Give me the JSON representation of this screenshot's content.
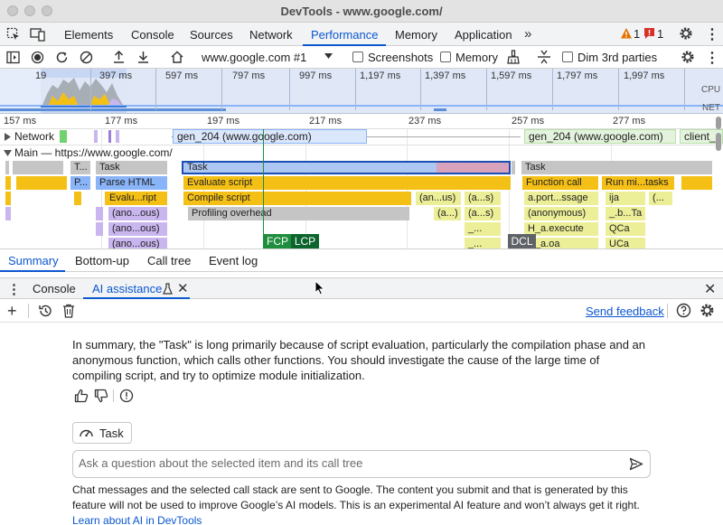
{
  "window": {
    "title": "DevTools - www.google.com/"
  },
  "main_tabs": [
    {
      "label": "Elements"
    },
    {
      "label": "Console"
    },
    {
      "label": "Sources"
    },
    {
      "label": "Network"
    },
    {
      "label": "Performance"
    },
    {
      "label": "Memory"
    },
    {
      "label": "Application"
    }
  ],
  "badges": {
    "warnings": "1",
    "errors": "1"
  },
  "perf_toolbar": {
    "target": "www.google.com #1",
    "screenshots_label": "Screenshots",
    "memory_label": "Memory",
    "dim_label": "Dim 3rd parties"
  },
  "overview": {
    "ticks": [
      "19",
      "397 ms",
      "597 ms",
      "797 ms",
      "997 ms",
      "1,197 ms",
      "1,397 ms",
      "1,597 ms",
      "1,797 ms",
      "1,997 ms"
    ],
    "cpu_label": "CPU",
    "net_label": "NET"
  },
  "ruler": {
    "ticks": [
      "157 ms",
      "177 ms",
      "197 ms",
      "217 ms",
      "237 ms",
      "257 ms",
      "277 ms"
    ]
  },
  "tracks": {
    "network_label": "Network",
    "network_items": [
      "gen_204 (www.google.com)",
      "gen_204 (www.google.com)",
      "client_"
    ],
    "main_label": "Main — https://www.google.com/"
  },
  "flame": {
    "row1": [
      "T...",
      "Task",
      "Task",
      "Task"
    ],
    "row2": [
      "P...",
      "Parse HTML",
      "Evaluate script",
      "Function call",
      "Run mi...tasks"
    ],
    "row3": [
      "Evalu...ript",
      "Compile script",
      "(an...us)",
      "(a...s)",
      "a.port...ssage",
      "ija",
      "(..."
    ],
    "row4": [
      "(ano...ous)",
      "Profiling overhead",
      "(a...)",
      "(a...s)",
      "(anonymous)",
      "_.b...Ta"
    ],
    "row5": [
      "(ano...ous)",
      "_...",
      "H_a.execute",
      "QCa"
    ],
    "row6": [
      "(ano...ous)",
      "_...",
      "H_a.oa",
      "UCa"
    ],
    "markers": [
      "FCP",
      "LCP",
      "DCL"
    ]
  },
  "bottom_tabs": [
    "Summary",
    "Bottom-up",
    "Call tree",
    "Event log"
  ],
  "drawer": {
    "tabs": [
      "Console",
      "AI assistance"
    ]
  },
  "ai": {
    "send_feedback": "Send feedback",
    "answer": "In summary, the \"Task\" is long primarily because of script evaluation, particularly the compilation phase and an anonymous function, which calls other functions. You should investigate the cause of the large time of compiling script, and try to optimize module initialization.",
    "context_label": "Task",
    "input_placeholder": "Ask a question about the selected item and its call tree",
    "disclaimer_text": "Chat messages and the selected call stack are sent to Google. The content you submit and that is generated by this feature will not be used to improve Google’s AI models. This is an experimental AI feature and won’t always get it right.",
    "learn_link": "Learn about AI in DevTools"
  },
  "colors": {
    "accent": "#0b57d0",
    "task_grey": "#c5c5c5",
    "script_yellow": "#f5c016",
    "light_yellow": "#ecef98",
    "purple": "#c9b6ef",
    "fcp_green": "#1e8e3e",
    "lcp_green": "#0d652d",
    "dcl_grey": "#5f6368"
  }
}
